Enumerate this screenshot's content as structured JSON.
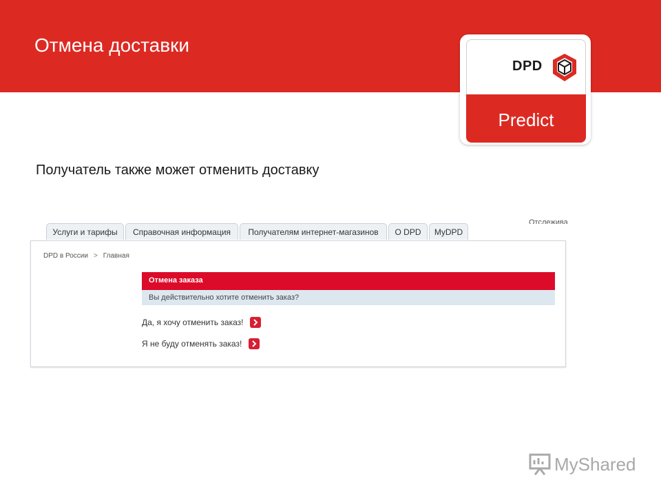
{
  "slide": {
    "title": "Отмена доставки",
    "subtitle": "Получатель также может отменить доставку"
  },
  "logo": {
    "brand": "DPD",
    "product": "Predict"
  },
  "tabs": [
    {
      "label": "Услуги и тарифы"
    },
    {
      "label": "Справочная информация"
    },
    {
      "label": "Получателям интернет-магазинов"
    },
    {
      "label": "О DPD"
    },
    {
      "label": "MyDPD"
    }
  ],
  "cut_off_text": "Отслежива",
  "breadcrumb": {
    "items": [
      "DPD в России",
      "Главная"
    ],
    "separator": ">"
  },
  "cancel_dialog": {
    "header": "Отмена заказа",
    "question": "Вы действительно хотите отменить заказ?",
    "confirm_label": "Да, я хочу отменить заказ!",
    "decline_label": "Я не буду отменять заказ!"
  },
  "watermark": {
    "text": "MyShared"
  },
  "colors": {
    "header_red": "#dc2a23",
    "dialog_red": "#dc0b2a",
    "question_bg": "#dde7ef",
    "arrow_red": "#d71f33"
  },
  "icons": [
    "cube-logo-icon",
    "arrow-right-icon",
    "presentation-icon"
  ]
}
